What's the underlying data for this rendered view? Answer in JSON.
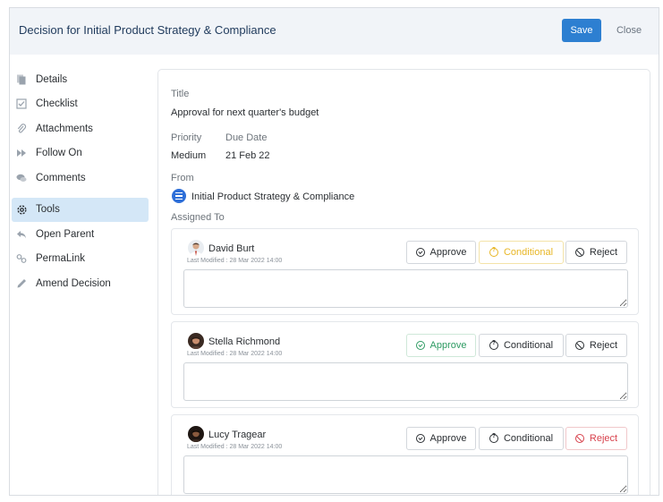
{
  "header": {
    "title": "Decision for Initial Product Strategy & Compliance",
    "save_label": "Save",
    "close_label": "Close"
  },
  "sidebar": {
    "items": [
      {
        "label": "Details",
        "icon": "copy-icon"
      },
      {
        "label": "Checklist",
        "icon": "checkbox-icon"
      },
      {
        "label": "Attachments",
        "icon": "paperclip-icon"
      },
      {
        "label": "Follow On",
        "icon": "fast-forward-icon"
      },
      {
        "label": "Comments",
        "icon": "comments-icon"
      },
      {
        "label": "Tools",
        "icon": "gear-icon",
        "active": true
      },
      {
        "label": "Open Parent",
        "icon": "reply-icon"
      },
      {
        "label": "PermaLink",
        "icon": "link-icon"
      },
      {
        "label": "Amend Decision",
        "icon": "pencil-icon"
      }
    ]
  },
  "main": {
    "title_label": "Title",
    "title_value": "Approval for next quarter's budget",
    "priority_label": "Priority",
    "priority_value": "Medium",
    "due_label": "Due Date",
    "due_value": "21 Feb 22",
    "from_label": "From",
    "from_value": "Initial Product Strategy & Compliance",
    "assigned_label": "Assigned To"
  },
  "assignees": [
    {
      "name": "David Burt",
      "modified": "Last Modified : 28 Mar 2022 14:00",
      "approve": "Approve",
      "conditional": "Conditional",
      "reject": "Reject",
      "selected": "conditional"
    },
    {
      "name": "Stella Richmond",
      "modified": "Last Modified : 28 Mar 2022 14:00",
      "approve": "Approve",
      "conditional": "Conditional",
      "reject": "Reject",
      "selected": "approve"
    },
    {
      "name": "Lucy Tragear",
      "modified": "Last Modified : 28 Mar 2022 14:00",
      "approve": "Approve",
      "conditional": "Conditional",
      "reject": "Reject",
      "selected": "reject"
    }
  ],
  "colors": {
    "accent": "#2d7fd1",
    "approve": "#2e9b63",
    "conditional": "#e8b625",
    "reject": "#d8424d",
    "active_nav": "#d4e7f7"
  }
}
